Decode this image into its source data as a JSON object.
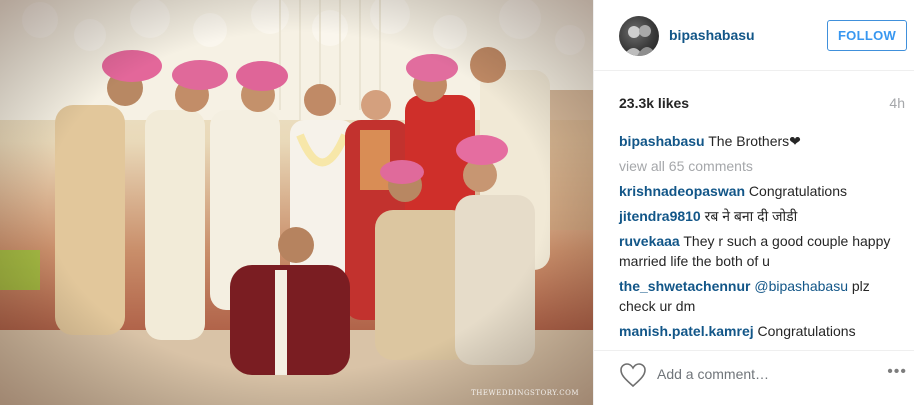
{
  "photo": {
    "watermark": "THEWEDDINGSTORY.COM"
  },
  "header": {
    "username": "bipashabasu",
    "follow_label": "FOLLOW"
  },
  "stats": {
    "likes": "23.3k likes",
    "time_ago": "4h"
  },
  "caption": {
    "user": "bipashabasu",
    "text": "The Brothers❤︎"
  },
  "view_all_label": "view all 65 comments",
  "comments": [
    {
      "user": "krishnadeopaswan",
      "text": " Congratulations"
    },
    {
      "user": "jitendra9810",
      "text": " रब ने बना दी जोडी"
    },
    {
      "user": "ruvekaaa",
      "text": " They r such a good couple happy married life the both of u"
    },
    {
      "user": "the_shwetachennur",
      "mention": " @bipashabasu",
      "text": " plz check ur dm"
    },
    {
      "user": "manish.patel.kamrej",
      "text": " Congratulations"
    }
  ],
  "footer": {
    "add_comment_placeholder": "Add a comment…",
    "more_label": "•••"
  },
  "colors": {
    "link": "#125688",
    "follow": "#3897f0",
    "muted": "#a5a7aa"
  }
}
